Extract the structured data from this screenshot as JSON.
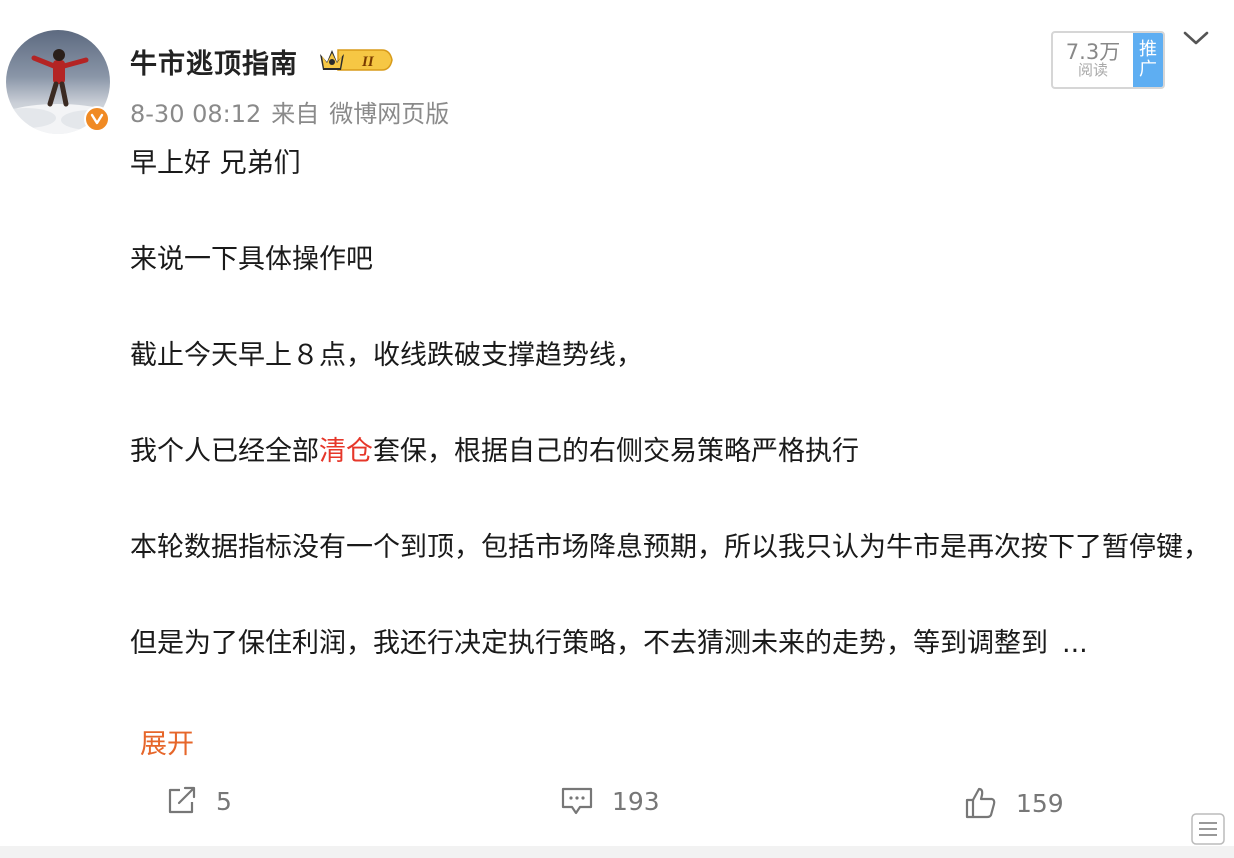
{
  "post": {
    "username": "牛市逃顶指南",
    "vip_level": "II",
    "date": "8-30 08:12",
    "source_prefix": "来自",
    "source": "微博网页版",
    "read_count": "7.3万",
    "read_label": "阅读",
    "promote_label_1": "推",
    "promote_label_2": "广",
    "paragraphs": {
      "p1": "早上好 兄弟们",
      "p2": "来说一下具体操作吧",
      "p3": "截止今天早上８点，收线跌破支撑趋势线，",
      "p4_before": "我个人已经全部",
      "p4_highlight": "清仓",
      "p4_after": "套保，根据自己的右侧交易策略严格执行",
      "p5": "本轮数据指标没有一个到顶，包括市场降息预期，所以我只认为牛市是再次按下了暂停键，",
      "p6": "但是为了保住利润，我还行决定执行策略，不去猜测未来的走势，等到调整到",
      "ellipsis": "..."
    },
    "expand_label": "展开",
    "highlight_color": "#e6372a",
    "actions": {
      "share_count": "5",
      "comment_count": "193",
      "like_count": "159"
    }
  }
}
